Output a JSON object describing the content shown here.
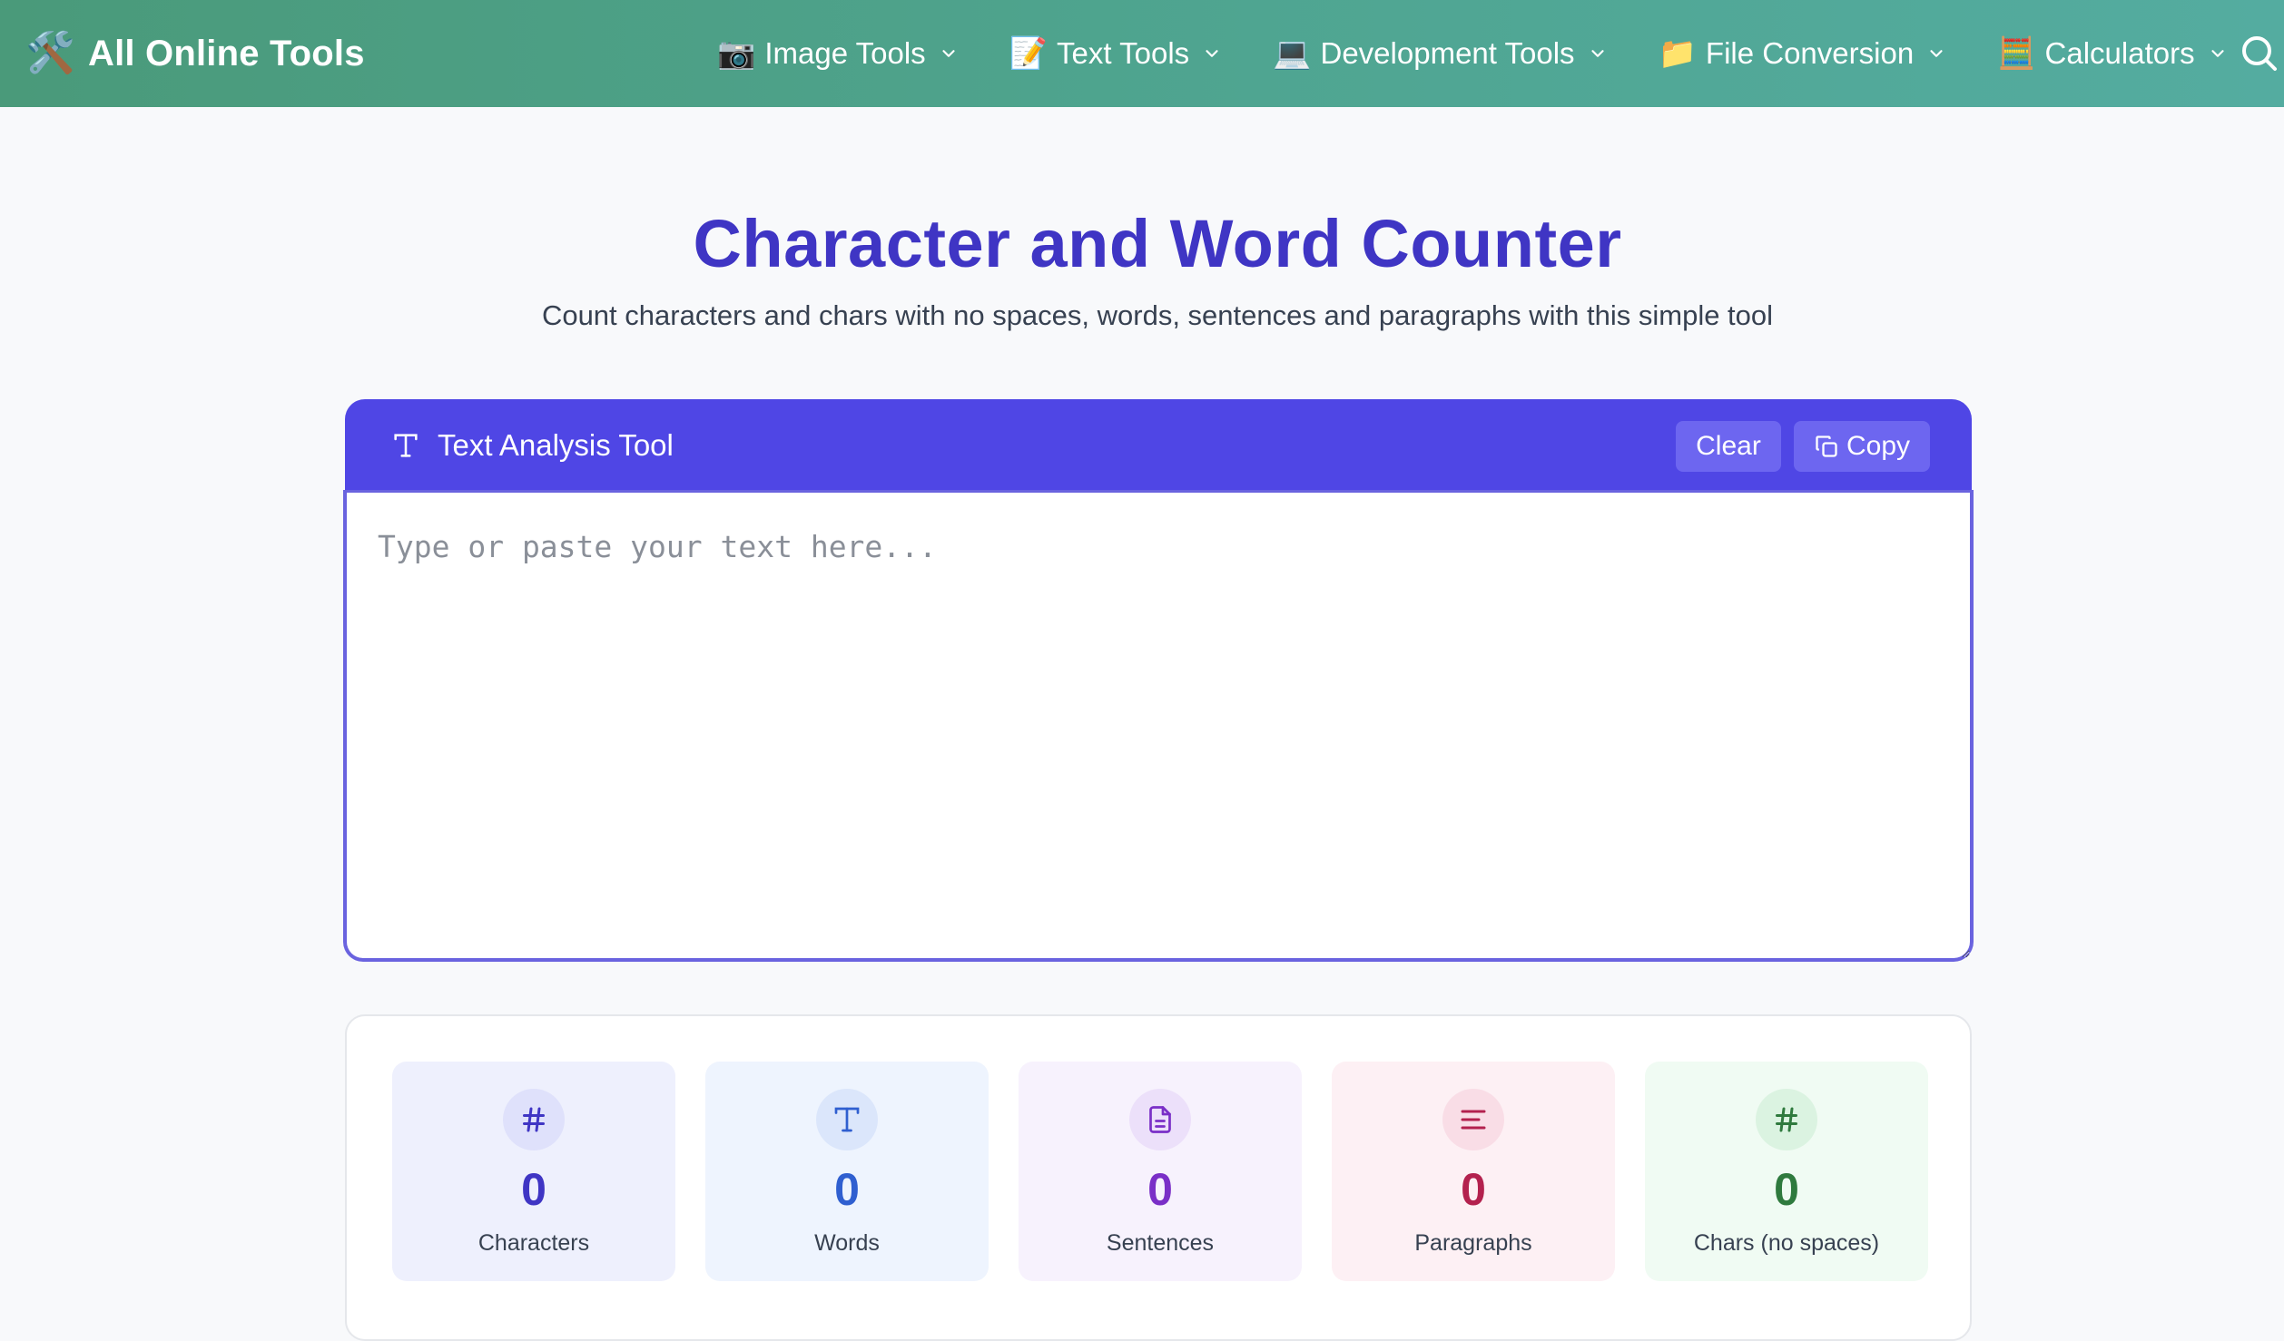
{
  "navbar": {
    "brand_icon": "🛠️",
    "brand": "All Online Tools",
    "items": [
      {
        "emoji": "📷",
        "label": "Image Tools"
      },
      {
        "emoji": "📝",
        "label": "Text Tools"
      },
      {
        "emoji": "💻",
        "label": "Development Tools"
      },
      {
        "emoji": "📁",
        "label": "File Conversion"
      },
      {
        "emoji": "🧮",
        "label": "Calculators"
      }
    ]
  },
  "hero": {
    "title": "Character and Word Counter",
    "subtitle": "Count characters and chars with no spaces, words, sentences and paragraphs with this simple tool"
  },
  "tool": {
    "title": "Text Analysis Tool",
    "clear_label": "Clear",
    "copy_label": "Copy",
    "placeholder": "Type or paste your text here...",
    "value": ""
  },
  "stats": [
    {
      "value": "0",
      "label": "Characters",
      "color": "#3f35c4",
      "bg": "#eef0fd",
      "icon_bg": "#dfe1fb",
      "icon": "hash-icon"
    },
    {
      "value": "0",
      "label": "Words",
      "color": "#2f5fd0",
      "bg": "#eef4fe",
      "icon_bg": "#dbe6fb",
      "icon": "text-icon"
    },
    {
      "value": "0",
      "label": "Sentences",
      "color": "#7a2fc7",
      "bg": "#f7f2fd",
      "icon_bg": "#ece0fa",
      "icon": "document-icon"
    },
    {
      "value": "0",
      "label": "Paragraphs",
      "color": "#b3214e",
      "bg": "#fdf0f4",
      "icon_bg": "#f9dde6",
      "icon": "paragraph-icon"
    },
    {
      "value": "0",
      "label": "Chars (no spaces)",
      "color": "#2f7a3e",
      "bg": "#f0fbf3",
      "icon_bg": "#dbf3e1",
      "icon": "hash-icon"
    }
  ]
}
